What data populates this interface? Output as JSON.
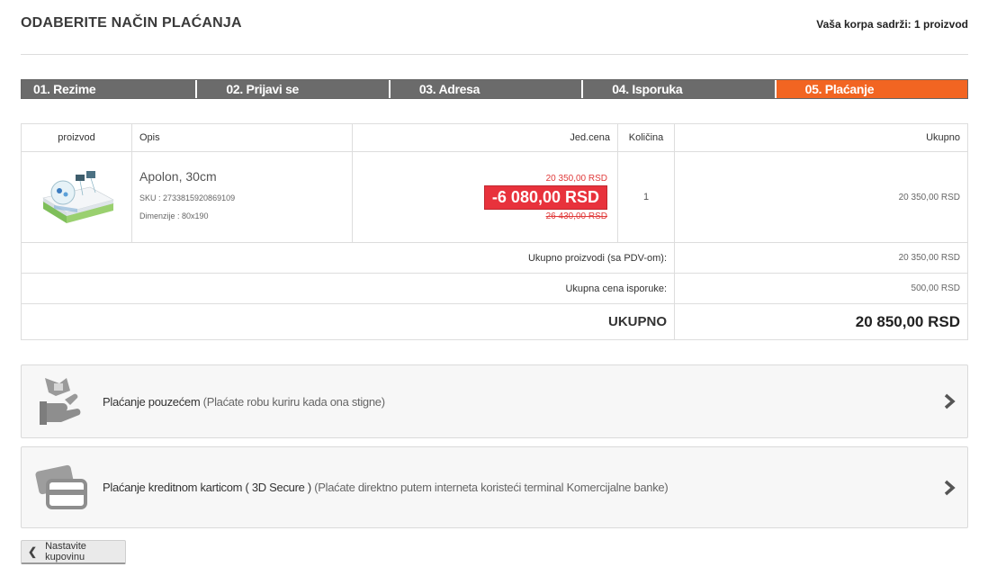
{
  "header": {
    "title": "ODABERITE NAČIN PLAĆANJA",
    "cart_summary": "Vaša korpa sadrži: 1 proizvod"
  },
  "steps": [
    {
      "label": "01. Rezime",
      "active": false
    },
    {
      "label": "02. Prijavi se",
      "active": false
    },
    {
      "label": "03. Adresa",
      "active": false
    },
    {
      "label": "04. Isporuka",
      "active": false
    },
    {
      "label": "05. Plaćanje",
      "active": true
    }
  ],
  "table": {
    "headers": {
      "product": "proizvod",
      "description": "Opis",
      "unit_price": "Jed.cena",
      "quantity": "Količina",
      "total": "Ukupno"
    },
    "item": {
      "name": "Apolon, 30cm",
      "sku": "SKU : 2733815920869109",
      "dimensions": "Dimenzije : 80x190",
      "price_current": "20 350,00 RSD",
      "discount": "-6 080,00 RSD",
      "price_old": "26 430,00 RSD",
      "quantity": "1",
      "total": "20 350,00 RSD"
    },
    "summary": {
      "products_label": "Ukupno proizvodi (sa PDV-om):",
      "products_value": "20 350,00 RSD",
      "shipping_label": "Ukupna cena isporuke:",
      "shipping_value": "500,00 RSD",
      "grand_label": "UKUPNO",
      "grand_value": "20 850,00 RSD"
    }
  },
  "payment_options": [
    {
      "icon": "cash-hand-icon",
      "title": "Plaćanje pouzećem",
      "subtitle": "(Plaćate robu kuriru kada ona stigne)"
    },
    {
      "icon": "credit-card-icon",
      "title": "Plaćanje kreditnom karticom ( 3D Secure )",
      "subtitle": "(Plaćate direktno putem interneta koristeći terminal Komercijalne banke)"
    }
  ],
  "back_button": {
    "label": "Nastavite kupovinu"
  },
  "colors": {
    "active_step": "#f26522",
    "inactive_step": "#6b6b6b",
    "discount_bg": "#e8323c",
    "old_price": "#e03a3a"
  }
}
